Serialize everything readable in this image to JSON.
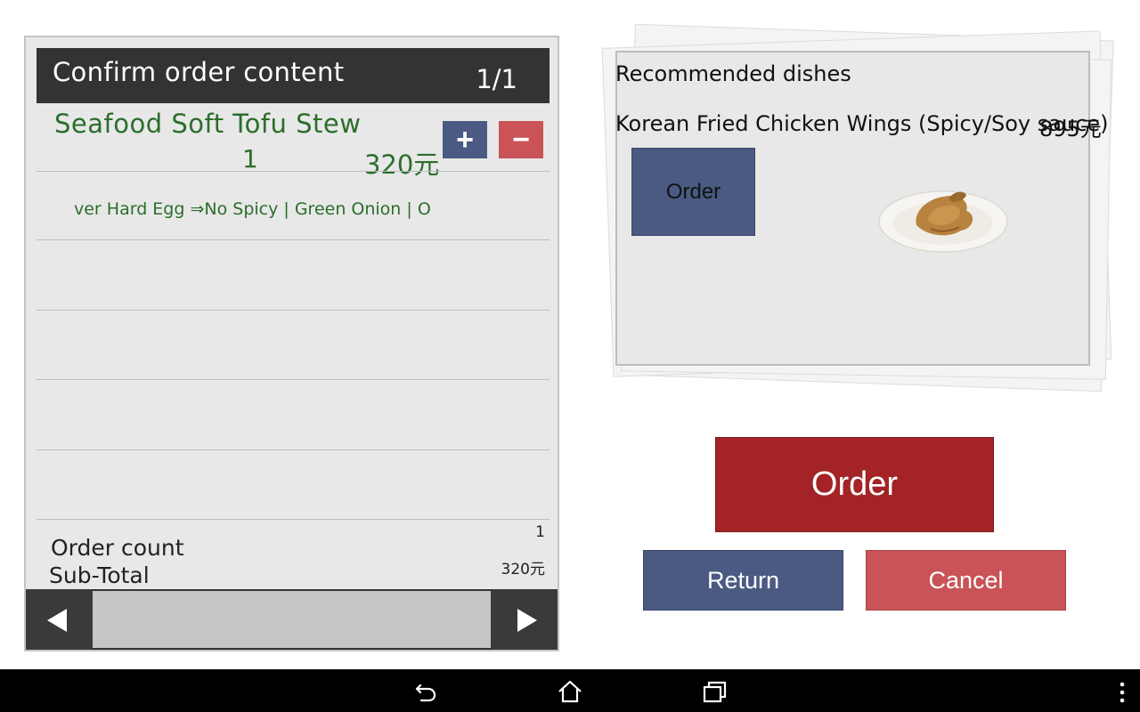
{
  "order_panel": {
    "title": "Confirm order content",
    "page_indicator": "1/1",
    "item": {
      "name": "Seafood Soft Tofu Stew",
      "quantity": "1",
      "price": "320元",
      "options": "ver Hard Egg  ⇒No Spicy | Green Onion | O",
      "plus_label": "+",
      "minus_label": "−"
    },
    "summary": {
      "count_label": "Order count",
      "count_value": "1",
      "subtotal_label": "Sub-Total",
      "subtotal_value": "320元"
    }
  },
  "recommended": {
    "title": "Recommended dishes",
    "dish_name": "Korean Fried Chicken Wings (Spicy/Soy sauce)",
    "dish_price": "895元",
    "order_label": "Order"
  },
  "actions": {
    "order_label": "Order",
    "return_label": "Return",
    "cancel_label": "Cancel"
  },
  "colors": {
    "header_bg": "#333333",
    "item_text": "#2b6e2b",
    "blue_button": "#4a5a82",
    "red_button": "#c95356",
    "order_button": "#a32326"
  },
  "icons": {
    "pager_prev": "triangle-left-icon",
    "pager_next": "triangle-right-icon",
    "nav_back": "back-icon",
    "nav_home": "home-icon",
    "nav_recents": "recents-icon",
    "nav_menu": "overflow-menu-icon"
  }
}
